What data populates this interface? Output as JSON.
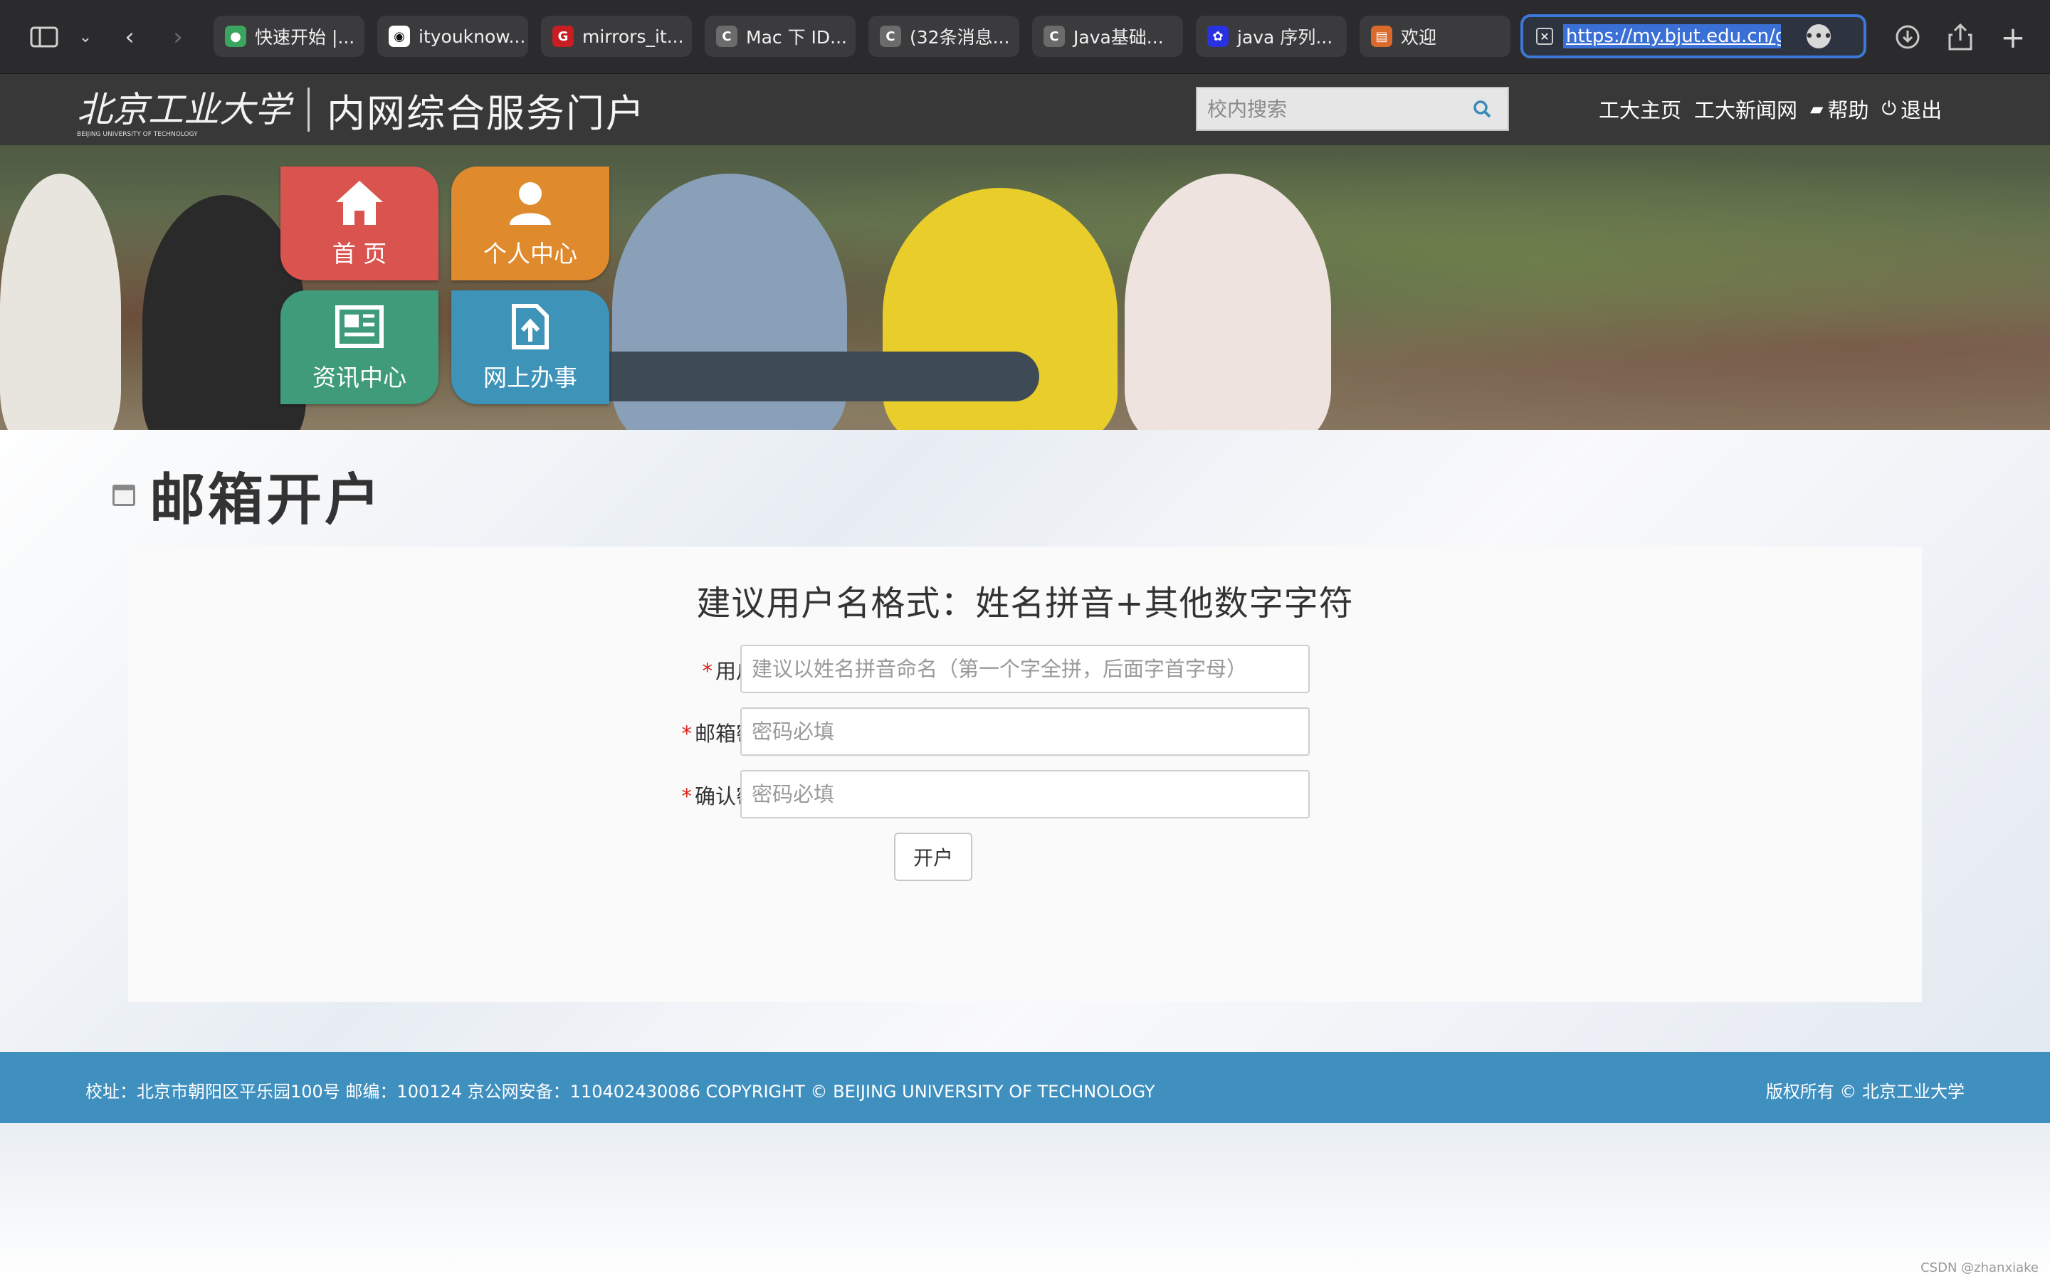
{
  "browser": {
    "tabs": [
      {
        "label": "快速开始 |...",
        "icon": "leaf-icon",
        "color": "#3aa55f"
      },
      {
        "label": "ityouknow...",
        "icon": "github-icon",
        "color": "#ffffff"
      },
      {
        "label": "mirrors_it...",
        "icon": "gitee-icon",
        "color": "#c71d23"
      },
      {
        "label": "Mac 下 ID...",
        "icon": "csdn-icon",
        "color": "#6b6b6b"
      },
      {
        "label": "(32条消息...",
        "icon": "csdn-icon",
        "color": "#6b6b6b"
      },
      {
        "label": "Java基础...",
        "icon": "csdn-icon",
        "color": "#6b6b6b"
      },
      {
        "label": "java 序列...",
        "icon": "baidu-icon",
        "color": "#2932e1"
      },
      {
        "label": "欢迎",
        "icon": "bjut-icon",
        "color": "#d96a2b"
      }
    ],
    "url": "https://my.bjut.edu.cn/group"
  },
  "site": {
    "logo_text": "北京工业大学",
    "logo_subtext": "BEIJING UNIVERSITY OF TECHNOLOGY",
    "portal_title": "内网综合服务门户",
    "search_placeholder": "校内搜索",
    "links": {
      "home": "工大主页",
      "news": "工大新闻网",
      "help": "帮助",
      "logout": "退出"
    }
  },
  "tiles": [
    {
      "label": "首 页",
      "color": "#d9534f"
    },
    {
      "label": "个人中心",
      "color": "#e08a2e"
    },
    {
      "label": "资讯中心",
      "color": "#3f9b79"
    },
    {
      "label": "网上办事",
      "color": "#3e93b8"
    }
  ],
  "page": {
    "title": "邮箱开户",
    "hint": "建议用户名格式：姓名拼音+其他数字字符",
    "fields": {
      "username": {
        "label": "用户名",
        "placeholder": "建议以姓名拼音命名（第一个字全拼，后面字首字母）"
      },
      "password": {
        "label": "邮箱密码",
        "placeholder": "密码必填"
      },
      "confirm": {
        "label": "确认密码",
        "placeholder": "密码必填"
      }
    },
    "required_mark": "*",
    "submit": "开户"
  },
  "footer": {
    "left": "校址：北京市朝阳区平乐园100号 邮编：100124 京公网安备：110402430086 COPYRIGHT © BEIJING UNIVERSITY OF TECHNOLOGY",
    "right": "版权所有 © 北京工业大学"
  },
  "watermark": "CSDN @zhanxiake"
}
